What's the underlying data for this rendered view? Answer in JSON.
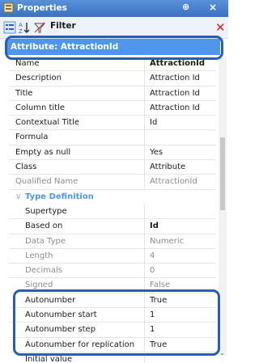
{
  "panel": {
    "title": "Properties",
    "pin_glyph": "⊕",
    "close_glyph": "×"
  },
  "toolbar": {
    "filter_label": "Filter"
  },
  "header": {
    "text": "Attribute: AttractionId"
  },
  "rows": [
    {
      "name": "Name",
      "value": "AttractionId",
      "style": "bold"
    },
    {
      "name": "Description",
      "value": "Attraction Id"
    },
    {
      "name": "Title",
      "value": "Attraction Id"
    },
    {
      "name": "Column title",
      "value": "Attraction Id"
    },
    {
      "name": "Contextual Title",
      "value": "Id"
    },
    {
      "name": "Formula",
      "value": ""
    },
    {
      "name": "Empty as null",
      "value": "Yes"
    },
    {
      "name": "Class",
      "value": "Attribute"
    },
    {
      "name": "Qualified Name",
      "value": "AttractionId",
      "style": "dim"
    },
    {
      "name": "Type Definition",
      "value": "",
      "style": "section"
    },
    {
      "name": "Supertype",
      "value": "",
      "indent": true
    },
    {
      "name": "Based on",
      "value": "Id",
      "indent": true,
      "valstyle": "bold"
    },
    {
      "name": "Data Type",
      "value": "Numeric",
      "indent": true,
      "style": "dim"
    },
    {
      "name": "Length",
      "value": "4",
      "indent": true,
      "style": "dim"
    },
    {
      "name": "Decimals",
      "value": "0",
      "indent": true,
      "style": "dim"
    },
    {
      "name": "Signed",
      "value": "False",
      "indent": true,
      "style": "dim"
    },
    {
      "name": "Autonumber",
      "value": "True",
      "indent": true
    },
    {
      "name": "Autonumber start",
      "value": "1",
      "indent": true
    },
    {
      "name": "Autonumber step",
      "value": "1",
      "indent": true
    },
    {
      "name": "Autonumber for replication",
      "value": "True",
      "indent": true
    },
    {
      "name": "Initial value",
      "value": "",
      "indent": true
    }
  ],
  "colors": {
    "accent": "#4f96ea",
    "highlight": "#2b5db0",
    "title_bar": "#3a72c2",
    "close": "#d42020"
  }
}
